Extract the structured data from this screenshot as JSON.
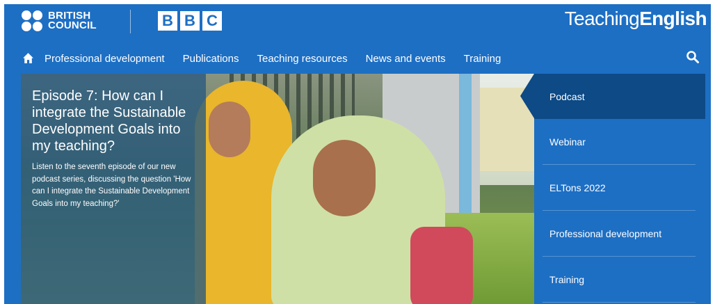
{
  "header": {
    "british_council_line1": "BRITISH",
    "british_council_line2": "COUNCIL",
    "bbc_letters": [
      "B",
      "B",
      "C"
    ],
    "teaching_light": "Teaching",
    "teaching_bold": "English"
  },
  "icons": {
    "home": "home-icon",
    "search": "search-icon"
  },
  "nav": {
    "items": [
      {
        "label": "Professional development"
      },
      {
        "label": "Publications"
      },
      {
        "label": "Teaching resources"
      },
      {
        "label": "News and events"
      },
      {
        "label": "Training"
      }
    ]
  },
  "hero": {
    "title": "Episode 7: How can I integrate the Sustainable Development Goals into my teaching?",
    "description": "Listen to the seventh episode of our new podcast series, discussing the question 'How can I integrate the Sustainable Development Goals into my teaching?'"
  },
  "tabs": [
    {
      "label": "Podcast",
      "active": true
    },
    {
      "label": "Webinar",
      "active": false
    },
    {
      "label": "ELTons 2022",
      "active": false
    },
    {
      "label": "Professional development",
      "active": false
    },
    {
      "label": "Training",
      "active": false
    }
  ],
  "colors": {
    "brand_blue": "#1d6fc4",
    "active_tab": "#0d4a86",
    "overlay": "#285880"
  }
}
